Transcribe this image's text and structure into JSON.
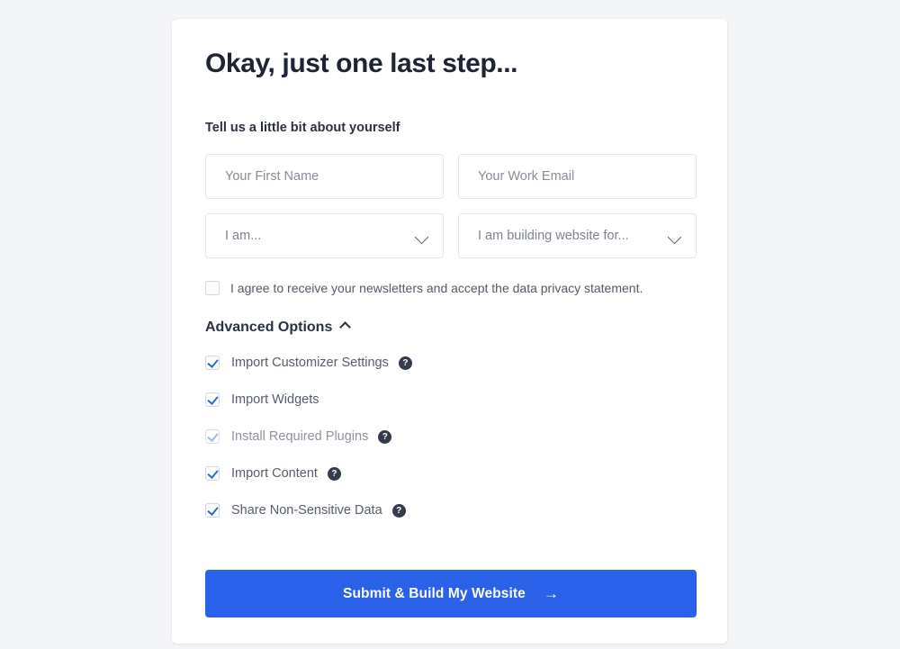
{
  "card": {
    "heading": "Okay, just one last step...",
    "subheading": "Tell us a little bit about yourself",
    "fields": [
      {
        "name": "first-name",
        "placeholder": "Your First Name",
        "value": "",
        "type": "text"
      },
      {
        "name": "work-email",
        "placeholder": "Your Work Email",
        "value": "",
        "type": "text"
      },
      {
        "name": "i-am",
        "placeholder": "I am...",
        "value": "I am...",
        "type": "select"
      },
      {
        "name": "building-for",
        "placeholder": "I am building website for...",
        "value": "I am building website for...",
        "type": "select"
      }
    ],
    "agree": {
      "label": "I agree to receive your newsletters and accept the data privacy statement.",
      "checked": false
    },
    "advanced": {
      "title": "Advanced Options",
      "expanded": true,
      "chevron": "chevron-up-icon",
      "options": [
        {
          "label": "Import Customizer Settings",
          "checked": true,
          "disabled": false,
          "help": true
        },
        {
          "label": "Import Widgets",
          "checked": true,
          "disabled": false,
          "help": false
        },
        {
          "label": "Install Required Plugins",
          "checked": true,
          "disabled": true,
          "help": true
        },
        {
          "label": "Import Content",
          "checked": true,
          "disabled": false,
          "help": true
        },
        {
          "label": "Share Non-Sensitive Data",
          "checked": true,
          "disabled": false,
          "help": true
        }
      ],
      "help_glyph": "?"
    },
    "submit": {
      "label": "Submit & Build My Website",
      "arrow": "→"
    }
  },
  "colors": {
    "accent": "#2962e8",
    "page_background": "#f4f5f7",
    "card_background": "#ffffff",
    "heading_text": "#1d2434",
    "body_text": "#555d6b",
    "placeholder_text": "#868d98",
    "help_badge": "#333b4d",
    "checkbox_check": "#2b6cd4",
    "checkbox_check_disabled": "#9cb9e2",
    "field_border": "#e3e6ea"
  }
}
